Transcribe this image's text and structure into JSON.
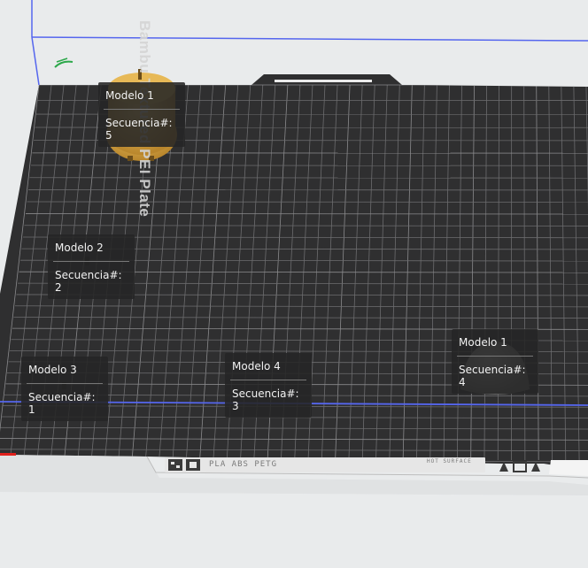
{
  "plate": {
    "label": "Bambu Textured PEI Plate",
    "bottom_bar_text": "PLA ABS PETG",
    "surface_text": "HOT SURFACE"
  },
  "objects": [
    {
      "name": "Modelo 1",
      "sequence": "Secuencia#: 5"
    },
    {
      "name": "Modelo 2",
      "sequence": "Secuencia#: 2"
    },
    {
      "name": "Modelo 3",
      "sequence": "Secuencia#: 1"
    },
    {
      "name": "Modelo 4",
      "sequence": "Secuencia#: 3"
    },
    {
      "name": "Modelo 1",
      "sequence": "Secuencia#: 4"
    }
  ],
  "colors": {
    "background": "#e9ebec",
    "plate": "#2f2f30",
    "grid": "#6e6e70",
    "boundary": "#5566ee",
    "model_gold": "#d9a844",
    "model_grey": "#8c8c8c",
    "marker_green": "#2ca84a",
    "marker_red": "#e0201c"
  },
  "icons": [
    "pencil-icon",
    "bambu-logo-icon",
    "warning-icon"
  ]
}
